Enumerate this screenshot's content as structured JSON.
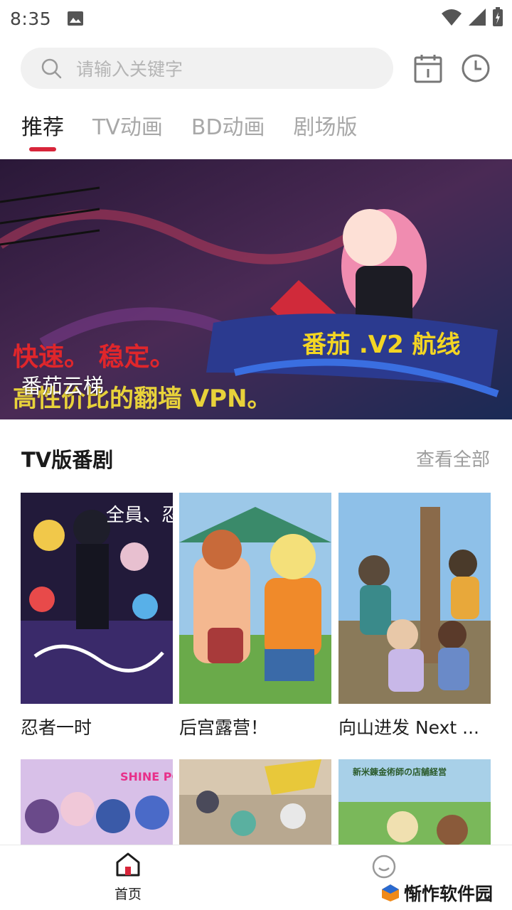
{
  "status_bar": {
    "time": "8:35"
  },
  "search": {
    "placeholder": "请输入关键字"
  },
  "tabs": [
    {
      "label": "推荐",
      "active": true
    },
    {
      "label": "TV动画",
      "active": false
    },
    {
      "label": "BD动画",
      "active": false
    },
    {
      "label": "剧场版",
      "active": false
    }
  ],
  "banner": {
    "title": "番茄云梯",
    "text_top": "番茄 .V2 航线",
    "text_mid": "快速。 稳定。",
    "text_bottom": "高性价比的翻墙 VPN。",
    "dot_count": 4,
    "active_dot": 1
  },
  "section": {
    "title": "TV版番剧",
    "more_label": "查看全部",
    "items": [
      {
        "title": "忍者一时",
        "poster_text": "全員、忍者"
      },
      {
        "title": "后宫露营！"
      },
      {
        "title": "向山进发 Next ..."
      }
    ],
    "next_row_posters": [
      "SHINE POST",
      "",
      "新米錬金術師の店舗経営"
    ]
  },
  "bottom_nav": {
    "home_label": "首页"
  },
  "watermark": {
    "text": "惭怍软件园"
  },
  "colors": {
    "accent": "#d8253a",
    "tab_inactive": "#a8a8a8"
  }
}
